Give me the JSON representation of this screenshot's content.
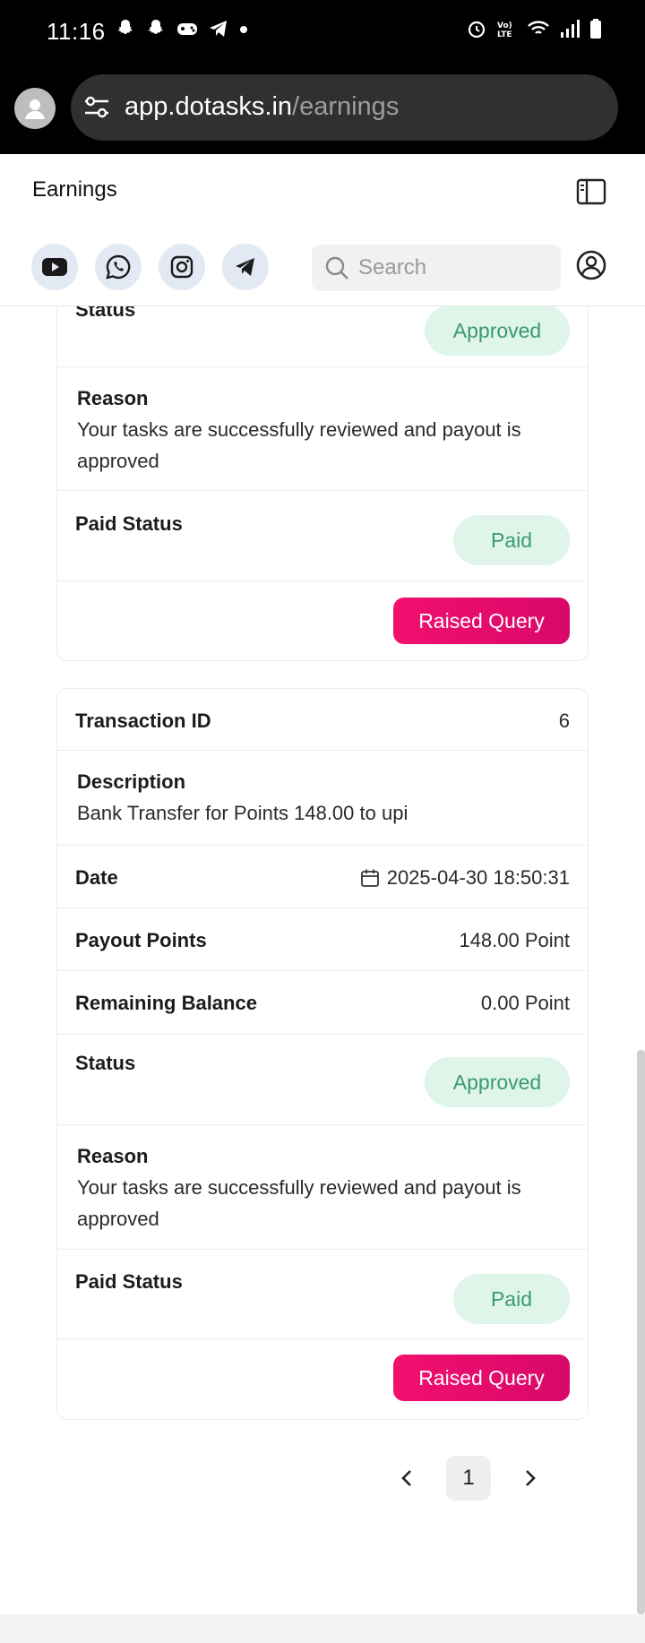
{
  "status_bar": {
    "time": "11:16"
  },
  "browser": {
    "url_host": "app.dotasks.in",
    "url_path": "/earnings"
  },
  "header": {
    "title": "Earnings",
    "search_placeholder": "Search",
    "social_icons": [
      "youtube-icon",
      "whatsapp-icon",
      "instagram-icon",
      "telegram-icon"
    ]
  },
  "labels": {
    "transaction_id": "Transaction ID",
    "description": "Description",
    "date": "Date",
    "payout_points": "Payout Points",
    "remaining_balance": "Remaining Balance",
    "status": "Status",
    "reason": "Reason",
    "paid_status": "Paid Status",
    "raised_query": "Raised Query"
  },
  "cards": [
    {
      "status": "Approved",
      "reason": "Your tasks are successfully reviewed and payout is approved",
      "paid_status": "Paid"
    },
    {
      "transaction_id": "6",
      "description": "Bank Transfer for Points 148.00 to upi",
      "date": "2025-04-30 18:50:31",
      "payout_points": "148.00 Point",
      "remaining_balance": "0.00 Point",
      "status": "Approved",
      "reason": "Your tasks are successfully reviewed and payout is approved",
      "paid_status": "Paid"
    }
  ],
  "pagination": {
    "current_page": "1"
  },
  "colors": {
    "accent": "#e80b6c",
    "approved_bg": "#dff5ea",
    "approved_text": "#3a9a6e"
  }
}
